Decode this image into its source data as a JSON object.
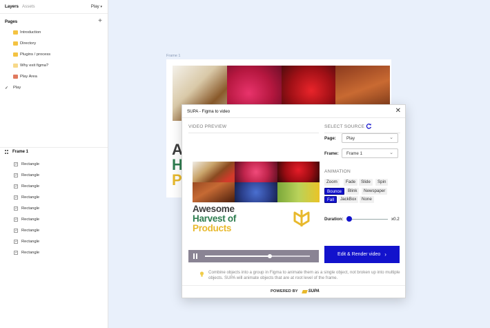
{
  "left_panel": {
    "tabs": [
      "Layers",
      "Assets"
    ],
    "page_selector": "Play",
    "pages_header": "Pages",
    "pages": [
      {
        "label": "Introduction",
        "color": "#f4c342"
      },
      {
        "label": "Directory",
        "color": "#f4c342"
      },
      {
        "label": "Plugins / process",
        "color": "#f4c342"
      },
      {
        "label": "Why exit figma?",
        "color": "#f7d98a"
      },
      {
        "label": "Play Area",
        "color": "#e07a5f"
      },
      {
        "label": "Play",
        "color": "#ffffff"
      }
    ],
    "frame_name": "Frame 1",
    "layers": [
      "Rectangle",
      "Rectangle",
      "Rectangle",
      "Rectangle",
      "Rectangle",
      "Rectangle",
      "Rectangle",
      "Rectangle",
      "Rectangle"
    ]
  },
  "canvas": {
    "frame_label": "Frame 1",
    "bg_letters": [
      "A",
      "H",
      "P"
    ]
  },
  "dialog": {
    "title": "SUPA - Figma to video",
    "video_preview_label": "VIDEO PREVIEW",
    "select_source_label": "SELECT SOURCE",
    "page_label": "Page:",
    "page_value": "Play",
    "frame_label": "Frame:",
    "frame_value": "Frame 1",
    "animation_label": "ANIMATION",
    "animations": [
      "Zoom",
      "Fade",
      "Slide",
      "Spin",
      "Bounce",
      "Blink",
      "Newspaper",
      "Fall",
      "JackBox",
      "None"
    ],
    "selected_animations": [
      "Bounce",
      "Fall"
    ],
    "duration_label": "Duration:",
    "duration_value": "x0.2",
    "render_button": "Edit & Render video",
    "tip": "Combine objects into a group in Figma to animate them as a single object, not broken up into multiple objects. SUPA will animate objects that are at root level of the frame.",
    "powered_by": "POWERED BY",
    "brand": "SUPA",
    "preview_title": [
      "Awesome",
      "Harvest of",
      "Products"
    ],
    "playback_progress": 0.62
  },
  "colors": {
    "accent": "#1212cc",
    "awesome": "#3b3b3b",
    "harvest": "#2e7d4f",
    "products": "#e8b92d"
  }
}
